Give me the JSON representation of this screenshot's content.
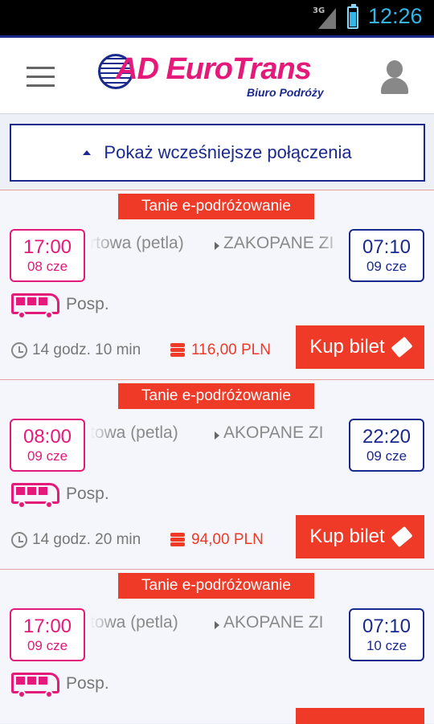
{
  "status_bar": {
    "network": "3G",
    "time": "12:26"
  },
  "header": {
    "logo_text": "AD EuroTrans",
    "logo_subtitle": "Biuro Podróży"
  },
  "earlier_button": {
    "label": "Pokaż wcześniejsze połączenia"
  },
  "connections": [
    {
      "badge": "Tanie e-podróżowanie",
      "dep_time": "17:00",
      "dep_date": "08 cze",
      "from": "rtowa (petla)",
      "to": "ZAKOPANE ZI",
      "arr_time": "07:10",
      "arr_date": "09 cze",
      "bus_type": "Posp.",
      "duration": "14 godz. 10 min",
      "price": "116,00 PLN",
      "buy_label": "Kup bilet"
    },
    {
      "badge": "Tanie e-podróżowanie",
      "dep_time": "08:00",
      "dep_date": "09 cze",
      "from": "towa (petla)",
      "to": "AKOPANE ZI",
      "arr_time": "22:20",
      "arr_date": "09 cze",
      "bus_type": "Posp.",
      "duration": "14 godz. 20 min",
      "price": "94,00 PLN",
      "buy_label": "Kup bilet"
    },
    {
      "badge": "Tanie e-podróżowanie",
      "dep_time": "17:00",
      "dep_date": "09 cze",
      "from": "towa (petla)",
      "to": "AKOPANE ZI",
      "arr_time": "07:10",
      "arr_date": "10 cze",
      "bus_type": "Posp."
    }
  ],
  "colors": {
    "brand_magenta": "#e4197a",
    "brand_navy": "#1a2a8c",
    "accent_red": "#ee3a27"
  }
}
